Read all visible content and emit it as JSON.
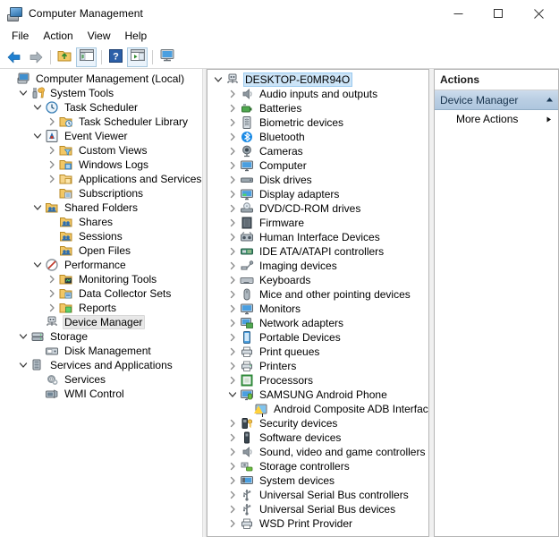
{
  "window": {
    "title": "Computer Management",
    "icon": "computer-management-icon",
    "controls": {
      "minimize": "minimize-icon",
      "maximize": "maximize-icon",
      "close": "close-icon"
    }
  },
  "menubar": {
    "items": [
      "File",
      "Action",
      "View",
      "Help"
    ]
  },
  "toolbar": {
    "buttons": [
      {
        "name": "back-button",
        "icon": "arrow-left-icon"
      },
      {
        "name": "forward-button",
        "icon": "arrow-right-icon"
      },
      {
        "name": "up-one-level-button",
        "icon": "folder-up-icon"
      },
      {
        "name": "show-hide-console-tree-button",
        "icon": "console-tree-icon"
      },
      {
        "name": "help-button",
        "icon": "question-mark-icon"
      },
      {
        "name": "show-hide-action-pane-button",
        "icon": "action-pane-icon"
      },
      {
        "name": "properties-button",
        "icon": "monitor-icon"
      }
    ]
  },
  "console_tree": {
    "root": "Computer Management (Local)",
    "items": [
      {
        "label": "Computer Management (Local)",
        "depth": 0,
        "twisty": "none",
        "icon": "computer-icon",
        "selected": false
      },
      {
        "label": "System Tools",
        "depth": 1,
        "twisty": "expanded",
        "icon": "tools-icon",
        "selected": false
      },
      {
        "label": "Task Scheduler",
        "depth": 2,
        "twisty": "expanded",
        "icon": "clock-icon",
        "selected": false
      },
      {
        "label": "Task Scheduler Library",
        "depth": 3,
        "twisty": "collapsed",
        "icon": "folder-clock-icon",
        "selected": false
      },
      {
        "label": "Event Viewer",
        "depth": 2,
        "twisty": "expanded",
        "icon": "event-viewer-icon",
        "selected": false
      },
      {
        "label": "Custom Views",
        "depth": 3,
        "twisty": "collapsed",
        "icon": "folder-filter-icon",
        "selected": false
      },
      {
        "label": "Windows Logs",
        "depth": 3,
        "twisty": "collapsed",
        "icon": "folder-log-icon",
        "selected": false
      },
      {
        "label": "Applications and Services Logs",
        "depth": 3,
        "twisty": "collapsed",
        "icon": "folder-apps-icon",
        "selected": false
      },
      {
        "label": "Subscriptions",
        "depth": 3,
        "twisty": "none",
        "icon": "folder-subscriptions-icon",
        "selected": false
      },
      {
        "label": "Shared Folders",
        "depth": 2,
        "twisty": "expanded",
        "icon": "shared-folders-icon",
        "selected": false
      },
      {
        "label": "Shares",
        "depth": 3,
        "twisty": "none",
        "icon": "shares-icon",
        "selected": false
      },
      {
        "label": "Sessions",
        "depth": 3,
        "twisty": "none",
        "icon": "sessions-icon",
        "selected": false
      },
      {
        "label": "Open Files",
        "depth": 3,
        "twisty": "none",
        "icon": "open-files-icon",
        "selected": false
      },
      {
        "label": "Performance",
        "depth": 2,
        "twisty": "expanded",
        "icon": "performance-icon",
        "selected": false
      },
      {
        "label": "Monitoring Tools",
        "depth": 3,
        "twisty": "collapsed",
        "icon": "folder-monitor-icon",
        "selected": false
      },
      {
        "label": "Data Collector Sets",
        "depth": 3,
        "twisty": "collapsed",
        "icon": "folder-data-icon",
        "selected": false
      },
      {
        "label": "Reports",
        "depth": 3,
        "twisty": "collapsed",
        "icon": "folder-reports-icon",
        "selected": false
      },
      {
        "label": "Device Manager",
        "depth": 2,
        "twisty": "none",
        "icon": "device-manager-icon",
        "selected": true
      },
      {
        "label": "Storage",
        "depth": 1,
        "twisty": "expanded",
        "icon": "storage-icon",
        "selected": false
      },
      {
        "label": "Disk Management",
        "depth": 2,
        "twisty": "none",
        "icon": "disk-management-icon",
        "selected": false
      },
      {
        "label": "Services and Applications",
        "depth": 1,
        "twisty": "expanded",
        "icon": "services-apps-icon",
        "selected": false
      },
      {
        "label": "Services",
        "depth": 2,
        "twisty": "none",
        "icon": "services-gear-icon",
        "selected": false
      },
      {
        "label": "WMI Control",
        "depth": 2,
        "twisty": "none",
        "icon": "wmi-control-icon",
        "selected": false
      }
    ]
  },
  "device_tree": {
    "items": [
      {
        "label": "DESKTOP-E0MR94O",
        "depth": 0,
        "twisty": "expanded",
        "icon": "computer-node-icon",
        "selected": true,
        "warning": false
      },
      {
        "label": "Audio inputs and outputs",
        "depth": 1,
        "twisty": "collapsed",
        "icon": "speaker-icon",
        "selected": false,
        "warning": false
      },
      {
        "label": "Batteries",
        "depth": 1,
        "twisty": "collapsed",
        "icon": "battery-icon",
        "selected": false,
        "warning": false
      },
      {
        "label": "Biometric devices",
        "depth": 1,
        "twisty": "collapsed",
        "icon": "fingerprint-icon",
        "selected": false,
        "warning": false
      },
      {
        "label": "Bluetooth",
        "depth": 1,
        "twisty": "collapsed",
        "icon": "bluetooth-icon",
        "selected": false,
        "warning": false
      },
      {
        "label": "Cameras",
        "depth": 1,
        "twisty": "collapsed",
        "icon": "camera-icon",
        "selected": false,
        "warning": false
      },
      {
        "label": "Computer",
        "depth": 1,
        "twisty": "collapsed",
        "icon": "monitor-icon",
        "selected": false,
        "warning": false
      },
      {
        "label": "Disk drives",
        "depth": 1,
        "twisty": "collapsed",
        "icon": "disk-drive-icon",
        "selected": false,
        "warning": false
      },
      {
        "label": "Display adapters",
        "depth": 1,
        "twisty": "collapsed",
        "icon": "display-adapter-icon",
        "selected": false,
        "warning": false
      },
      {
        "label": "DVD/CD-ROM drives",
        "depth": 1,
        "twisty": "collapsed",
        "icon": "dvd-drive-icon",
        "selected": false,
        "warning": false
      },
      {
        "label": "Firmware",
        "depth": 1,
        "twisty": "collapsed",
        "icon": "firmware-icon",
        "selected": false,
        "warning": false
      },
      {
        "label": "Human Interface Devices",
        "depth": 1,
        "twisty": "collapsed",
        "icon": "hid-icon",
        "selected": false,
        "warning": false
      },
      {
        "label": "IDE ATA/ATAPI controllers",
        "depth": 1,
        "twisty": "collapsed",
        "icon": "ide-controller-icon",
        "selected": false,
        "warning": false
      },
      {
        "label": "Imaging devices",
        "depth": 1,
        "twisty": "collapsed",
        "icon": "imaging-icon",
        "selected": false,
        "warning": false
      },
      {
        "label": "Keyboards",
        "depth": 1,
        "twisty": "collapsed",
        "icon": "keyboard-icon",
        "selected": false,
        "warning": false
      },
      {
        "label": "Mice and other pointing devices",
        "depth": 1,
        "twisty": "collapsed",
        "icon": "mouse-icon",
        "selected": false,
        "warning": false
      },
      {
        "label": "Monitors",
        "depth": 1,
        "twisty": "collapsed",
        "icon": "monitor-icon",
        "selected": false,
        "warning": false
      },
      {
        "label": "Network adapters",
        "depth": 1,
        "twisty": "collapsed",
        "icon": "network-adapter-icon",
        "selected": false,
        "warning": false
      },
      {
        "label": "Portable Devices",
        "depth": 1,
        "twisty": "collapsed",
        "icon": "portable-device-icon",
        "selected": false,
        "warning": false
      },
      {
        "label": "Print queues",
        "depth": 1,
        "twisty": "collapsed",
        "icon": "print-queue-icon",
        "selected": false,
        "warning": false
      },
      {
        "label": "Printers",
        "depth": 1,
        "twisty": "collapsed",
        "icon": "printer-icon",
        "selected": false,
        "warning": false
      },
      {
        "label": "Processors",
        "depth": 1,
        "twisty": "collapsed",
        "icon": "processor-icon",
        "selected": false,
        "warning": false
      },
      {
        "label": "SAMSUNG Android Phone",
        "depth": 1,
        "twisty": "expanded",
        "icon": "android-phone-icon",
        "selected": false,
        "warning": false
      },
      {
        "label": "Android Composite ADB Interface",
        "depth": 2,
        "twisty": "none",
        "icon": "adb-interface-icon",
        "selected": false,
        "warning": true
      },
      {
        "label": "Security devices",
        "depth": 1,
        "twisty": "collapsed",
        "icon": "security-device-icon",
        "selected": false,
        "warning": false
      },
      {
        "label": "Software devices",
        "depth": 1,
        "twisty": "collapsed",
        "icon": "software-device-icon",
        "selected": false,
        "warning": false
      },
      {
        "label": "Sound, video and game controllers",
        "depth": 1,
        "twisty": "collapsed",
        "icon": "sound-controller-icon",
        "selected": false,
        "warning": false
      },
      {
        "label": "Storage controllers",
        "depth": 1,
        "twisty": "collapsed",
        "icon": "storage-controller-icon",
        "selected": false,
        "warning": false
      },
      {
        "label": "System devices",
        "depth": 1,
        "twisty": "collapsed",
        "icon": "system-device-icon",
        "selected": false,
        "warning": false
      },
      {
        "label": "Universal Serial Bus controllers",
        "depth": 1,
        "twisty": "collapsed",
        "icon": "usb-controller-icon",
        "selected": false,
        "warning": false
      },
      {
        "label": "Universal Serial Bus devices",
        "depth": 1,
        "twisty": "collapsed",
        "icon": "usb-device-icon",
        "selected": false,
        "warning": false
      },
      {
        "label": "WSD Print Provider",
        "depth": 1,
        "twisty": "collapsed",
        "icon": "wsd-print-icon",
        "selected": false,
        "warning": false
      }
    ]
  },
  "actions_pane": {
    "header": "Actions",
    "group": {
      "label": "Device Manager",
      "collapse_icon": "chevron-up-icon"
    },
    "items": [
      {
        "label": "More Actions",
        "submenu_icon": "submenu-arrow-icon"
      }
    ]
  },
  "colors": {
    "accent_blue": "#2f7fc0",
    "selection_gray": "#e8e8e8",
    "selection_blue": "#cce4f7",
    "actions_group_bg": "#b9cee3",
    "warning_yellow": "#ffd13b",
    "folder_yellow": "#f0b648",
    "border_gray": "#b5b5b5"
  }
}
